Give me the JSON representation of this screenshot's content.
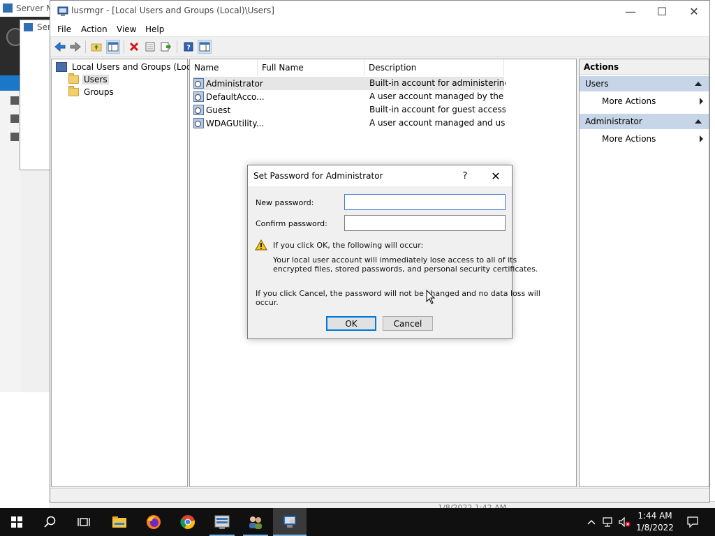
{
  "background": {
    "server_manager_title": "Server Ma",
    "server_manager_child_title": "Serv",
    "status_date": "1/8/2022 1:42 AM"
  },
  "window": {
    "title": "lusrmgr - [Local Users and Groups (Local)\\Users]",
    "controls": {
      "minimize": "—",
      "maximize": "☐",
      "close": "✕"
    }
  },
  "menubar": {
    "file": "File",
    "action": "Action",
    "view": "View",
    "help": "Help"
  },
  "toolbar": {
    "icons": [
      "back-arrow-icon",
      "forward-arrow-icon",
      "up-folder-icon",
      "show-hide-tree-icon",
      "delete-icon",
      "properties-icon",
      "export-list-icon",
      "help-icon",
      "show-hide-action-pane-icon"
    ]
  },
  "tree": {
    "root": "Local Users and Groups (Local)",
    "users": "Users",
    "groups": "Groups"
  },
  "list": {
    "columns": {
      "name": "Name",
      "full_name": "Full Name",
      "description": "Description"
    },
    "rows": [
      {
        "name": "Administrator",
        "full_name": "",
        "description": "Built-in account for administering..."
      },
      {
        "name": "DefaultAcco...",
        "full_name": "",
        "description": "A user account managed by the s..."
      },
      {
        "name": "Guest",
        "full_name": "",
        "description": "Built-in account for guest access t..."
      },
      {
        "name": "WDAGUtility...",
        "full_name": "",
        "description": "A user account managed and use..."
      }
    ]
  },
  "actions": {
    "header": "Actions",
    "section1": "Users",
    "section1_more": "More Actions",
    "section2": "Administrator",
    "section2_more": "More Actions"
  },
  "dialog": {
    "title": "Set Password for Administrator",
    "help": "?",
    "close": "✕",
    "new_password_label": "New password:",
    "new_password_value": "",
    "confirm_password_label": "Confirm password:",
    "confirm_password_value": "",
    "warning_heading": "If you click OK, the following will occur:",
    "warning_line1": "Your local user account will immediately lose access to all of its",
    "warning_line2": "encrypted files, stored passwords, and personal security certificates.",
    "cancel_note_line1": "If you click Cancel, the password will not be changed and no data loss will",
    "cancel_note_line2": "occur.",
    "ok_label": "OK",
    "cancel_label": "Cancel"
  },
  "taskbar": {
    "apps": [
      "start-icon",
      "search-icon",
      "task-view-icon",
      "file-explorer-icon",
      "firefox-icon",
      "chrome-icon",
      "server-manager-icon",
      "users-icon",
      "lusrmgr-icon"
    ],
    "time": "1:44 AM",
    "date": "1/8/2022",
    "tray_icons": [
      "chevron-up-icon",
      "network-icon",
      "volume-muted-icon",
      "notifications-icon"
    ]
  },
  "colors": {
    "accent": "#0078d7",
    "selection": "#cce4f7",
    "action_section": "#c7d5e8",
    "taskbar": "#101010"
  }
}
